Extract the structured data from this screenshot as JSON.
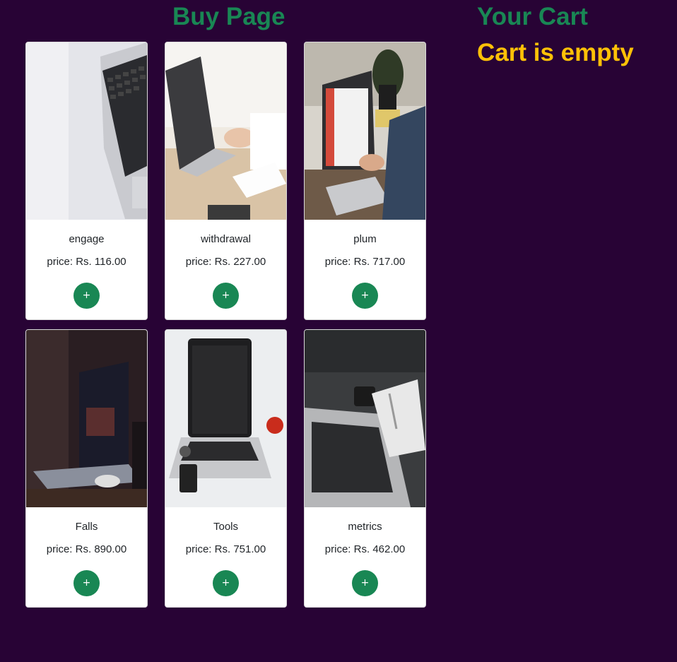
{
  "buy_page": {
    "title": "Buy Page",
    "currency_prefix": "price: Rs. ",
    "add_label": "+",
    "products": [
      {
        "name": "engage",
        "price": "116.00",
        "image": "laptop-keyboard-closeup-photo"
      },
      {
        "name": "withdrawal",
        "price": "227.00",
        "image": "person-typing-on-laptop-photo"
      },
      {
        "name": "plum",
        "price": "717.00",
        "image": "laptop-on-desk-with-plant-photo"
      },
      {
        "name": "Falls",
        "price": "890.00",
        "image": "dark-laptop-with-mouse-photo"
      },
      {
        "name": "Tools",
        "price": "751.00",
        "image": "laptop-with-apple-and-phone-photo"
      },
      {
        "name": "metrics",
        "price": "462.00",
        "image": "laptop-with-notebook-photo"
      }
    ]
  },
  "cart": {
    "title": "Your Cart",
    "empty_message": "Cart is empty"
  },
  "colors": {
    "background": "#280335",
    "heading_green": "#198754",
    "empty_yellow": "#ffc107",
    "button_green": "#198754"
  }
}
